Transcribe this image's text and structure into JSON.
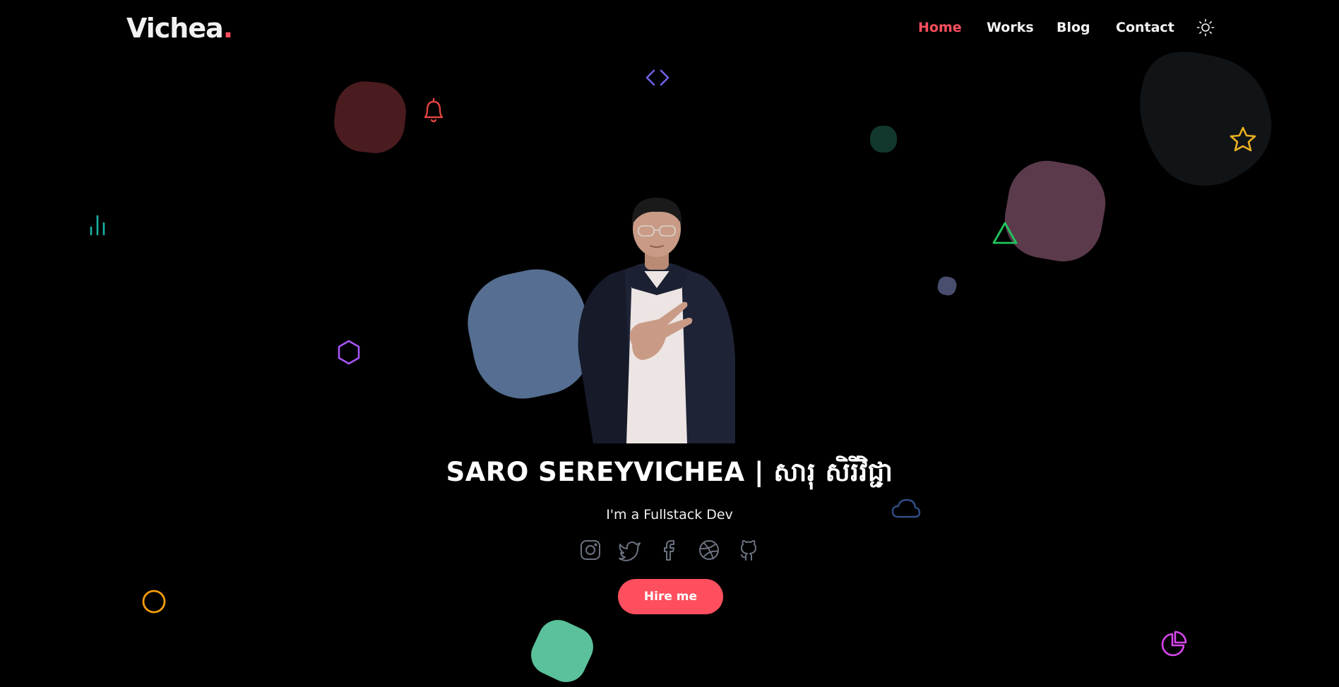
{
  "header": {
    "logo_text": "Vichea",
    "logo_dot": ".",
    "nav": [
      "Home",
      "Works",
      "Blog",
      "Contact"
    ],
    "active_nav": "Home"
  },
  "hero": {
    "name": "SARO SEREYVICHEA | សារុ សិរីវិជ្ជា",
    "role": "I'm a Fullstack Dev",
    "hire_label": "Hire me"
  },
  "social_icons": [
    "instagram-icon",
    "twitter-icon",
    "facebook-icon",
    "dribbble-icon",
    "github-icon"
  ],
  "colors": {
    "background": "#000000",
    "accent": "#ff4f5e",
    "text": "#f3f3f3",
    "social_icon": "#6b7280"
  }
}
